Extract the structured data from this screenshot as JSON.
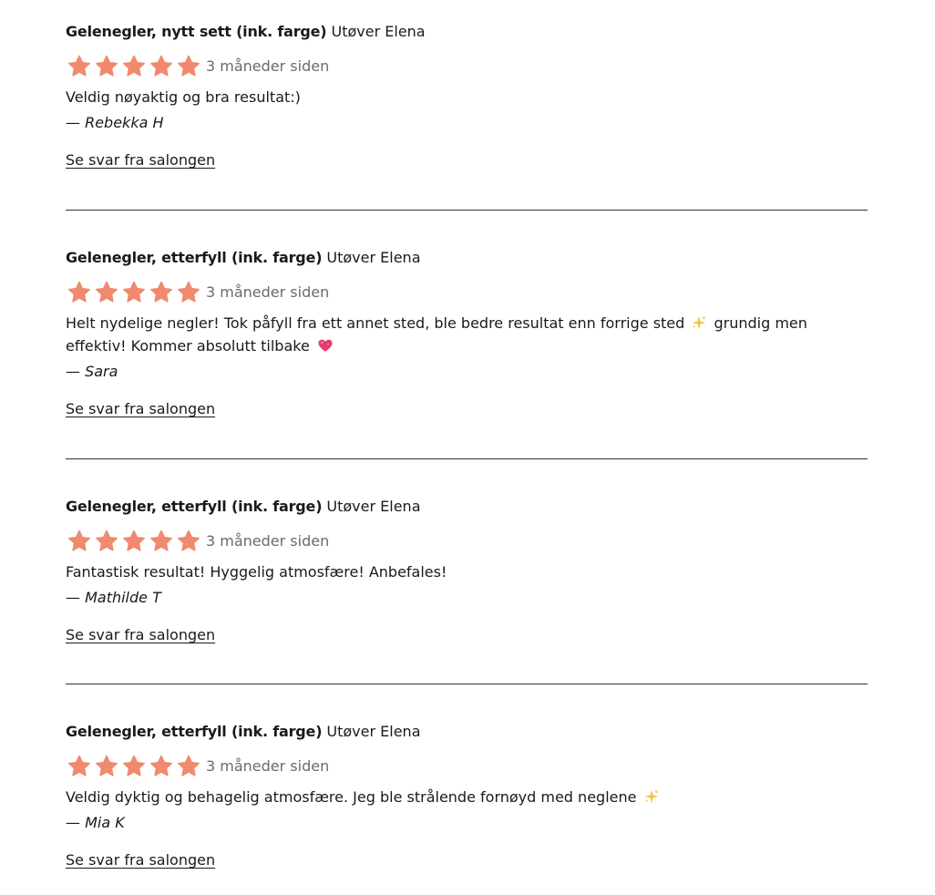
{
  "colors": {
    "star": "#f08a6e",
    "text": "#1a1a1a",
    "muted": "#6b6b6b",
    "divider": "#333333",
    "sparkle": "#f5c542",
    "heart": "#e63b6f"
  },
  "reviews": [
    {
      "service": "Gelenegler, nytt sett (ink. farge)",
      "performer": "Utøver Elena",
      "rating": 5,
      "date": "3 måneder siden",
      "text_parts": [
        "Veldig nøyaktig og bra resultat:)"
      ],
      "author": "— Rebekka H",
      "reply_label": "Se svar fra salongen"
    },
    {
      "service": "Gelenegler, etterfyll (ink. farge)",
      "performer": "Utøver Elena",
      "rating": 5,
      "date": "3 måneder siden",
      "text_parts": [
        "Helt nydelige negler! Tok påfyll fra ett annet sted, ble bedre resultat enn forrige sted",
        "grundig men effektiv! Kommer absolutt tilbake"
      ],
      "emoji": [
        "sparkles-emoji",
        "sparkling-heart-emoji"
      ],
      "author": "— Sara",
      "reply_label": "Se svar fra salongen"
    },
    {
      "service": "Gelenegler, etterfyll (ink. farge)",
      "performer": "Utøver Elena",
      "rating": 5,
      "date": "3 måneder siden",
      "text_parts": [
        "Fantastisk resultat! Hyggelig atmosfære! Anbefales!"
      ],
      "author": "— Mathilde T",
      "reply_label": "Se svar fra salongen"
    },
    {
      "service": "Gelenegler, etterfyll (ink. farge)",
      "performer": "Utøver Elena",
      "rating": 5,
      "date": "3 måneder siden",
      "text_parts": [
        "Veldig dyktig og behagelig atmosfære. Jeg ble strålende fornøyd med neglene"
      ],
      "emoji": [
        "sparkles-emoji"
      ],
      "author": "— Mia K",
      "reply_label": "Se svar fra salongen"
    }
  ]
}
